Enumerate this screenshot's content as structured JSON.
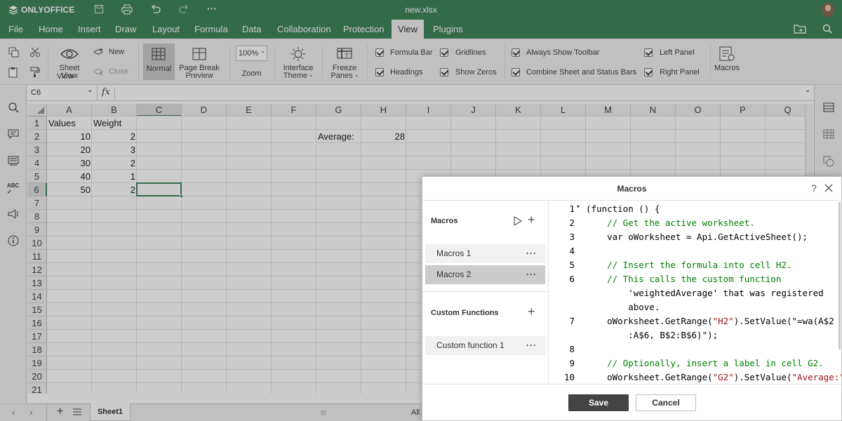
{
  "app": {
    "logo_text": "ONLYOFFICE",
    "file_name": "new.xlsx"
  },
  "menu": {
    "tabs": [
      "File",
      "Home",
      "Insert",
      "Draw",
      "Layout",
      "Formula",
      "Data",
      "Collaboration",
      "Protection",
      "View",
      "Plugins"
    ],
    "active": "View"
  },
  "ribbon": {
    "sheet_view": "Sheet View",
    "new": "New",
    "close": "Close",
    "normal": "Normal",
    "page_break_1": "Page Break",
    "page_break_2": "Preview",
    "zoom_value": "100%",
    "zoom": "Zoom",
    "interface_1": "Interface",
    "interface_2": "Theme",
    "freeze_1": "Freeze",
    "freeze_2": "Panes",
    "formula_bar": "Formula Bar",
    "headings": "Headings",
    "gridlines": "Gridlines",
    "show_zeros": "Show Zeros",
    "always_show_toolbar": "Always Show Toolbar",
    "combine_bars": "Combine Sheet and Status Bars",
    "left_panel": "Left Panel",
    "right_panel": "Right Panel",
    "macros": "Macros"
  },
  "formula": {
    "name_box": "C6",
    "fx": "fx",
    "value": ""
  },
  "grid": {
    "columns": [
      "A",
      "B",
      "C",
      "D",
      "E",
      "F",
      "G",
      "H",
      "I",
      "J",
      "K",
      "L",
      "M",
      "N",
      "O",
      "P",
      "Q"
    ],
    "rows": [
      "1",
      "2",
      "3",
      "4",
      "5",
      "6",
      "7",
      "8",
      "9",
      "10",
      "11",
      "12",
      "13",
      "14",
      "15",
      "16",
      "17",
      "18",
      "19",
      "20",
      "21"
    ],
    "cells": {
      "A1": "Values",
      "B1": "Weight",
      "A2": "10",
      "B2": "2",
      "A3": "20",
      "B3": "3",
      "A4": "30",
      "B4": "2",
      "A5": "40",
      "B5": "1",
      "A6": "50",
      "B6": "2",
      "G2": "Average:",
      "H2": "28"
    },
    "selected": "C6"
  },
  "sheets": {
    "tab": "Sheet1",
    "status": "All"
  },
  "dialog": {
    "title": "Macros",
    "help": "?",
    "macros_header": "Macros",
    "macros": [
      "Macros 1",
      "Macros 2"
    ],
    "selected_macro": "Macros 2",
    "custom_header": "Custom Functions",
    "custom_functions": [
      "Custom function 1"
    ],
    "dots": "···",
    "save": "Save",
    "cancel": "Cancel",
    "code_lines": [
      {
        "n": "1",
        "t": "(function () {"
      },
      {
        "n": "2",
        "t": "    // Get the active worksheet."
      },
      {
        "n": "3",
        "t": "    var oWorksheet = Api.GetActiveSheet();"
      },
      {
        "n": "4",
        "t": ""
      },
      {
        "n": "5",
        "t": "    // Insert the formula into cell H2."
      },
      {
        "n": "6",
        "t": "    // This calls the custom function"
      },
      {
        "n": "",
        "t": "        'weightedAverage' that was registered"
      },
      {
        "n": "",
        "t": "        above."
      },
      {
        "n": "7",
        "t": "    oWorksheet.GetRange(\"H2\").SetValue(\"=wa(A$2"
      },
      {
        "n": "",
        "t": "        :A$6, B$2:B$6)\");"
      },
      {
        "n": "8",
        "t": ""
      },
      {
        "n": "9",
        "t": "    // Optionally, insert a label in cell G2."
      },
      {
        "n": "10",
        "t": "    oWorksheet.GetRange(\"G2\").SetValue(\"Average:\""
      }
    ]
  }
}
